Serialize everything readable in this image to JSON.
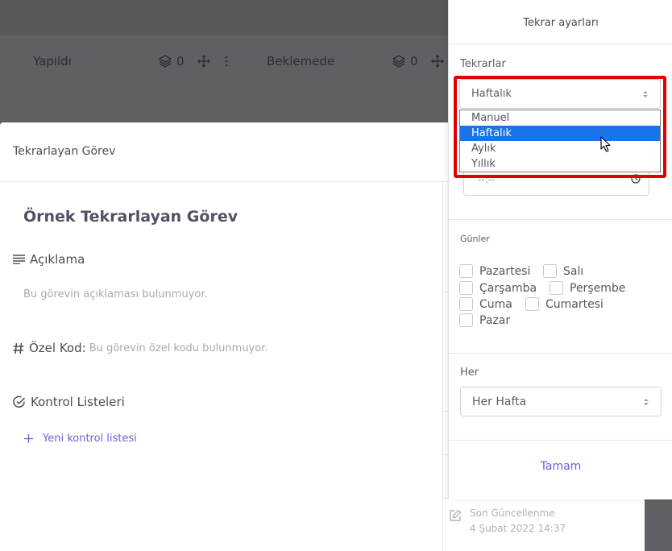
{
  "board": {
    "columns": [
      {
        "name": "Yapıldı",
        "count": "0"
      },
      {
        "name": "Beklemede",
        "count": "0"
      }
    ]
  },
  "modal": {
    "header_title": "Tekrarlayan Görev",
    "task_title": "Örnek Tekrarlayan Görev",
    "description_label": "Açıklama",
    "description_empty": "Bu görevin açıklaması bulunmuyor.",
    "custom_code_label": "Özel Kod:",
    "custom_code_empty": "Bu görevin özel kodu bulunmuyor.",
    "checklists_label": "Kontrol Listeleri",
    "new_checklist": "Yeni kontrol listesi",
    "last_updated_label": "Son Güncellenme",
    "last_updated_value": "4 Şubat 2022 14:37"
  },
  "panel": {
    "title": "Tekrar ayarları",
    "repeats_label": "Tekrarlar",
    "repeats_value": "Haftalık",
    "repeat_options": [
      "Manuel",
      "Haftalık",
      "Aylık",
      "Yıllık"
    ],
    "selected_option_index": 1,
    "time_value": "--:--",
    "days_label": "Günler",
    "days": [
      "Pazartesi",
      "Salı",
      "Çarşamba",
      "Perşembe",
      "Cuma",
      "Cumartesi",
      "Pazar"
    ],
    "every_label": "Her",
    "every_value": "Her Hafta",
    "ok_button": "Tamam"
  },
  "colors": {
    "accent": "#6a5fd6",
    "highlight_border": "#e00000",
    "selected_option_bg": "#1a73e8"
  }
}
